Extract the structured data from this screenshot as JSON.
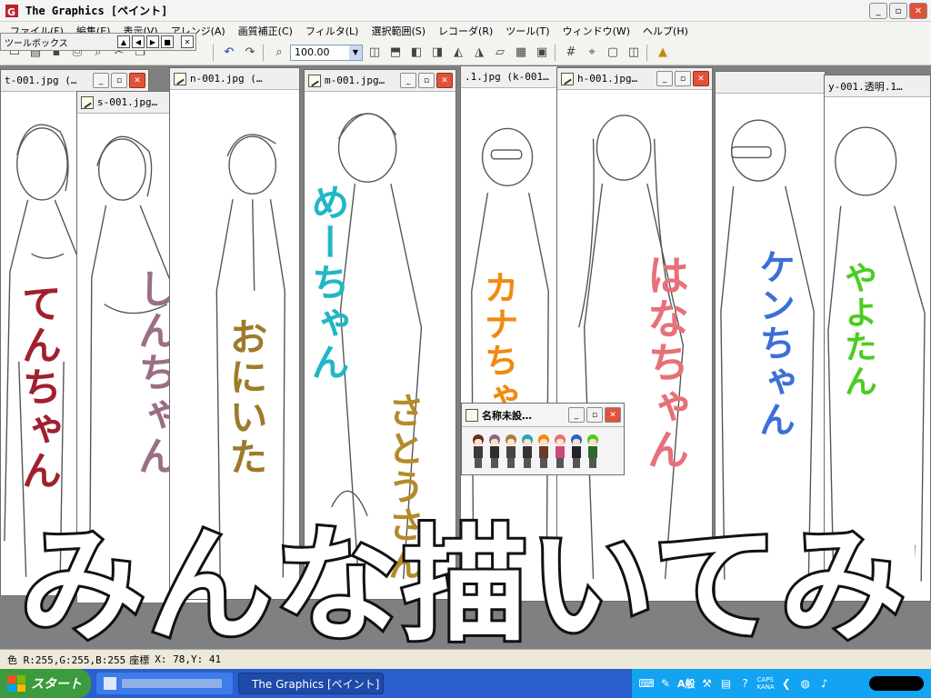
{
  "app": {
    "title": "The Graphics [ペイント]"
  },
  "menu": [
    "ファイル(F)",
    "編集(E)",
    "表示(V)",
    "アレンジ(A)",
    "画質補正(C)",
    "フィルタ(L)",
    "選択範囲(S)",
    "レコーダ(R)",
    "ツール(T)",
    "ウィンドウ(W)",
    "ヘルプ(H)"
  ],
  "toolbox": {
    "label": "ツールボックス"
  },
  "toolbar": {
    "zoom": "100.00"
  },
  "windows": [
    {
      "file": "t-001.jpg (…",
      "name": "てんちゃん",
      "color": "#a02030"
    },
    {
      "file": "s-001.jpg…",
      "name": "しんちゃん",
      "color": "#9a6f86"
    },
    {
      "file": "n-001.jpg (…",
      "name": "おにいた",
      "color": "#9e7a2a"
    },
    {
      "file": "m-001.jpg…",
      "name": "めーちゃん",
      "color": "#21b7c5"
    },
    {
      "file": ".1.jpg (k-001…",
      "name": "カナちゃん",
      "color": "#f08a10"
    },
    {
      "file": "h-001.jpg…",
      "name": "はなちゃん",
      "color": "#e7707a"
    },
    {
      "file": "",
      "name": "ケンちゃん",
      "color": "#3d6fd8"
    },
    {
      "file": "y-001.透明.1…",
      "name": "やよたん",
      "color": "#4ccc22"
    }
  ],
  "extra_label": {
    "text": "さとうさん",
    "color": "#b58a2a"
  },
  "palette": {
    "title": "名称未設…"
  },
  "big_title": "みんな描いてみた",
  "status": {
    "color": "色 R:255,G:255,B:255",
    "coords_label": "座標",
    "coords": "X:  78,Y:  41"
  },
  "taskbar": {
    "start": "スタート",
    "tasks": [
      "",
      "The Graphics [ペイント]"
    ],
    "tray_caps": "CAPS",
    "tray_kana": "KANA",
    "tray_ime": "A般"
  }
}
